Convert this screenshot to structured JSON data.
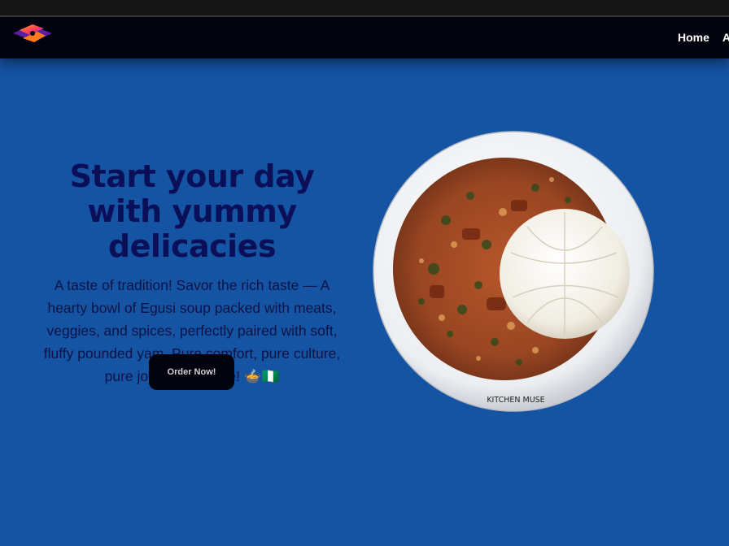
{
  "nav": {
    "links": [
      "Home",
      "About"
    ]
  },
  "hero": {
    "title": "Start your day with yummy delicacies",
    "description": "A taste of tradition! Savor the rich taste — A hearty bowl of Egusi soup packed with meats, veggies, and spices, perfectly paired with soft, fluffy pounded yam. Pure comfort, pure culture, pure joy in every bite! 🍲🇳🇬",
    "cta_label": "Order Now!"
  },
  "image": {
    "bowl_caption": "KITCHEN MUSE"
  },
  "colors": {
    "background": "#1553a3",
    "navbar": "#03030f",
    "title": "#0a0f58",
    "button": "#03030f"
  }
}
